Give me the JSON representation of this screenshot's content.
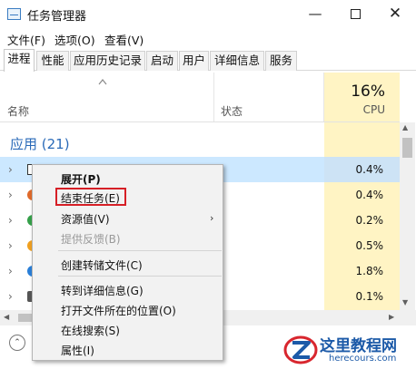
{
  "window": {
    "title": "任务管理器",
    "minimize": "—",
    "close": "✕"
  },
  "menu": [
    "文件(F)",
    "选项(O)",
    "查看(V)"
  ],
  "tabs": [
    "进程",
    "性能",
    "应用历史记录",
    "启动",
    "用户",
    "详细信息",
    "服务"
  ],
  "active_tab": "进程",
  "columns": {
    "name": "名称",
    "status": "状态",
    "cpu_total": "16%",
    "cpu": "CPU"
  },
  "group": {
    "label": "应用 (21)"
  },
  "rows": [
    {
      "cpu": "0.4%",
      "selected": true,
      "icon": "window-square-icon",
      "color": "#ffffff"
    },
    {
      "cpu": "0.4%",
      "selected": false,
      "icon": "app-icon",
      "color": "#e06a2b"
    },
    {
      "cpu": "0.2%",
      "selected": false,
      "icon": "app-icon",
      "color": "#35a04a"
    },
    {
      "cpu": "0.5%",
      "selected": false,
      "icon": "app-icon",
      "color": "#f0a020"
    },
    {
      "cpu": "1.8%",
      "selected": false,
      "icon": "app-icon",
      "color": "#2a7fd8"
    },
    {
      "cpu": "0.1%",
      "selected": false,
      "icon": "app-icon",
      "color": "#555555"
    }
  ],
  "context_menu": {
    "items": [
      {
        "label": "展开(P)",
        "bold": true
      },
      {
        "label": "结束任务(E)",
        "highlighted": true
      },
      {
        "label": "资源值(V)",
        "submenu": true
      },
      {
        "label": "提供反馈(B)",
        "disabled": true
      },
      {
        "label": "创建转储文件(C)"
      },
      {
        "label": "转到详细信息(G)"
      },
      {
        "label": "打开文件所在的位置(O)"
      },
      {
        "label": "在线搜索(S)"
      },
      {
        "label": "属性(I)"
      }
    ]
  },
  "watermark": {
    "title": "这里教程网",
    "url": "herecours.com"
  },
  "colors": {
    "accent": "#2a6ab8",
    "cpu_column": "#fff4c4",
    "selection": "#cce8ff",
    "highlight_box": "#d61f26"
  }
}
